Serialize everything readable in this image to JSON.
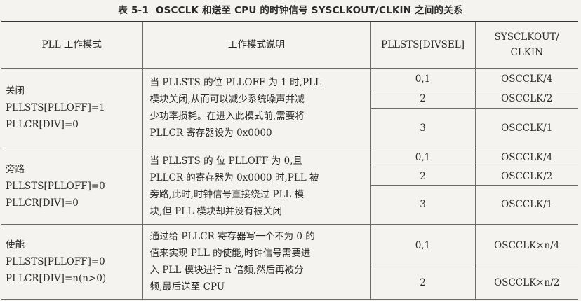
{
  "caption": {
    "number": "表 5-1",
    "title": "OSCCLK 和送至 CPU 的时钟信号 SYSCLKOUT/CLKIN 之间的关系"
  },
  "headers": {
    "mode": "PLL 工作模式",
    "desc": "工作模式说明",
    "divsel": "PLLSTS[DIVSEL]",
    "ratio_line1": "SYSCLKOUT/",
    "ratio_line2": "CLKIN"
  },
  "groups": [
    {
      "mode": [
        "关闭",
        "PLLSTS[PLLOFF]=1",
        "PLLCR[DIV]=0"
      ],
      "desc": [
        "当 PLLSTS 的位 PLLOFF 为 1 时,PLL",
        "模块关闭,从而可以减少系统噪声并减",
        "少功率损耗。在进入此模式前,需要将",
        "PLLCR 寄存器设为 0x0000"
      ],
      "rows": [
        {
          "divsel": "0,1",
          "ratio": "OSCCLK/4"
        },
        {
          "divsel": "2",
          "ratio": "OSCCLK/2"
        },
        {
          "divsel": "3",
          "ratio": "OSCCLK/1"
        }
      ]
    },
    {
      "mode": [
        "旁路",
        "PLLSTS[PLLOFF]=0",
        "PLLCR[DIV]=0"
      ],
      "desc": [
        "当 PLLSTS 的 位 PLLOFF 为 0,且",
        "PLLCR 的寄存器为 0x0000 时,PLL 被",
        "旁路,此时,时钟信号直接绕过 PLL 模",
        "块,但 PLL 模块却并没有被关闭"
      ],
      "rows": [
        {
          "divsel": "0,1",
          "ratio": "OSCCLK/4"
        },
        {
          "divsel": "2",
          "ratio": "OSCCLK/2"
        },
        {
          "divsel": "3",
          "ratio": "OSCCLK/1"
        }
      ]
    },
    {
      "mode": [
        "使能",
        "PLLSTS[PLLOFF]=0",
        "PLLCR[DIV]=n(n>0)"
      ],
      "desc": [
        "通过给 PLLCR 寄存器写一个不为 0 的",
        "值来实现 PLL 的使能,时钟信号需要进",
        "入 PLL 模块进行 n 倍频,然后再被分",
        "频,最后送至 CPU"
      ],
      "rows": [
        {
          "divsel": "0,1",
          "ratio": "OSCCLK×n/4"
        },
        {
          "divsel": "2",
          "ratio": "OSCCLK×n/2"
        }
      ]
    }
  ]
}
